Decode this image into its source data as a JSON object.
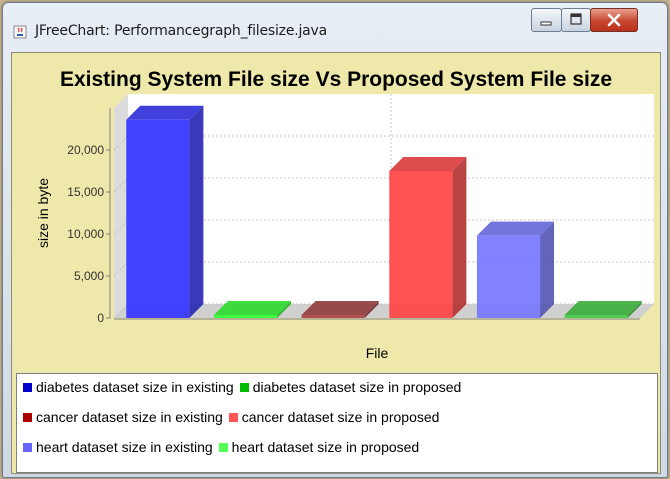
{
  "window": {
    "title": "JFreeChart: Performancegraph_filesize.java",
    "app_icon": "java-cup-icon",
    "buttons": [
      "minimize-icon",
      "maximize-icon",
      "close-icon"
    ]
  },
  "chart_data": {
    "type": "bar",
    "title": "Existing System File size Vs Proposed System File size",
    "xlabel": "File",
    "ylabel": "size in byte",
    "categories": [
      ""
    ],
    "yticks": [
      "0",
      "5,000",
      "10,000",
      "15,000",
      "20,000"
    ],
    "ylim": [
      0,
      25000
    ],
    "grid": true,
    "render": "3d",
    "legend_position": "bottom",
    "series": [
      {
        "name": "diabetes dataset size in existing",
        "values": [
          23600
        ],
        "color": "#3333ff"
      },
      {
        "name": "diabetes dataset size in proposed",
        "values": [
          0
        ],
        "color": "#33ff33"
      },
      {
        "name": "cancer dataset size in existing",
        "values": [
          0
        ],
        "color": "#aa4444"
      },
      {
        "name": "cancer dataset size in proposed",
        "values": [
          17500
        ],
        "color": "#ff4444"
      },
      {
        "name": "heart dataset size in existing",
        "values": [
          9800
        ],
        "color": "#7777ff"
      },
      {
        "name": "heart dataset size in proposed",
        "values": [
          0
        ],
        "color": "#44cc44"
      }
    ]
  },
  "legend_rows": [
    [
      {
        "label": "diabetes dataset size in existing",
        "color": "#0000cc"
      },
      {
        "label": "diabetes dataset size in proposed",
        "color": "#00bb00"
      }
    ],
    [
      {
        "label": "cancer dataset size in existing",
        "color": "#aa0000"
      },
      {
        "label": "cancer dataset size in proposed",
        "color": "#ff5555"
      }
    ],
    [
      {
        "label": "heart dataset size in existing",
        "color": "#6666ff"
      },
      {
        "label": "heart dataset size in proposed",
        "color": "#55ff55"
      }
    ]
  ]
}
